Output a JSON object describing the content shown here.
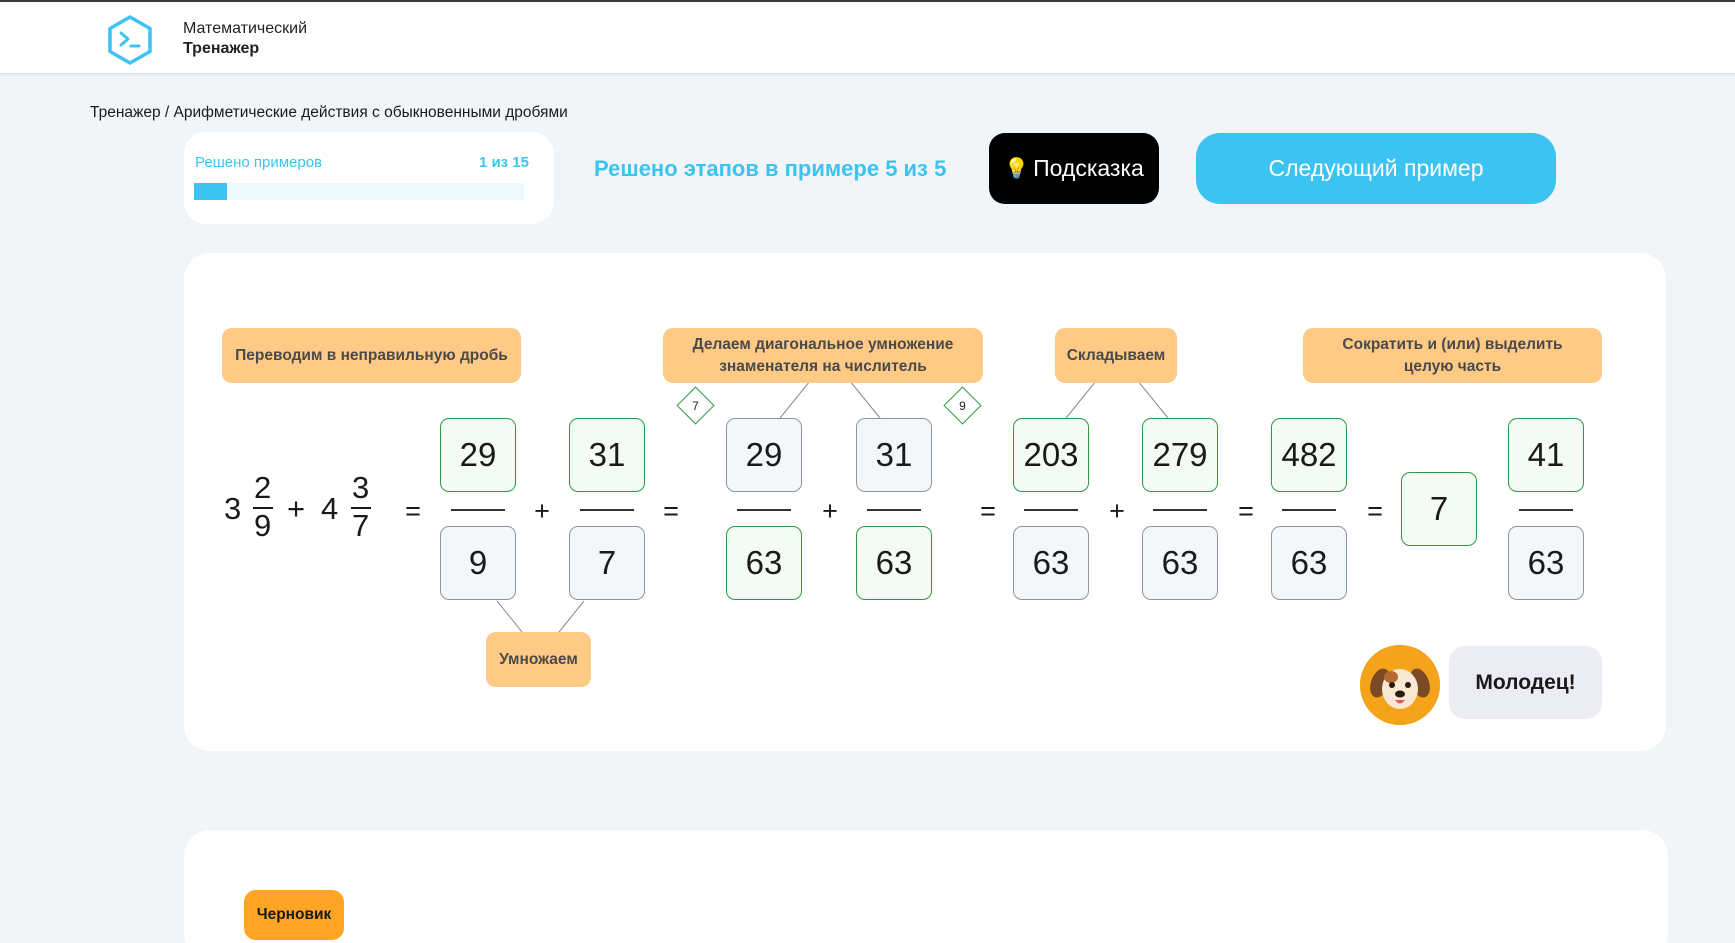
{
  "header": {
    "app_name_line1": "Математический",
    "app_name_line2": "Тренажер",
    "logo_icon": "terminal-hexagon-icon"
  },
  "breadcrumb": "Тренажер / Арифметические действия с обыкновенными дробями",
  "progress": {
    "label": "Решено примеров",
    "count_text": "1 из 15",
    "fraction": 0.1
  },
  "stage_status": "Решено этапов в примере 5 из 5",
  "hint_button": {
    "icon": "lightbulb-icon",
    "label": "Подсказка"
  },
  "next_button": {
    "label": "Следующий пример"
  },
  "steps": {
    "convert": "Переводим в неправильную дробь",
    "diagonal": "Делаем диагональное умножение знаменателя на числитель",
    "add": "Складываем",
    "reduce": "Сократить и (или) выделить целую часть",
    "multiply": "Умножаем"
  },
  "expression": {
    "mixed1": {
      "whole": "3",
      "num": "2",
      "den": "9"
    },
    "op1": "+",
    "mixed2": {
      "whole": "4",
      "num": "3",
      "den": "7"
    },
    "eq": "=",
    "improper1": {
      "num": "29",
      "den": "9"
    },
    "improper2": {
      "num": "31",
      "den": "7"
    },
    "common1": {
      "num": "29",
      "den": "63",
      "factor": "7"
    },
    "common2": {
      "num": "31",
      "den": "63",
      "factor": "9"
    },
    "product1": {
      "num": "203",
      "den": "63"
    },
    "product2": {
      "num": "279",
      "den": "63"
    },
    "sum": {
      "num": "482",
      "den": "63"
    },
    "result": {
      "whole": "7",
      "num": "41",
      "den": "63"
    },
    "plus": "+"
  },
  "mascot": {
    "icon": "puppy-avatar-icon",
    "message": "Молодец!"
  },
  "draft_button": {
    "label": "Черновик"
  }
}
